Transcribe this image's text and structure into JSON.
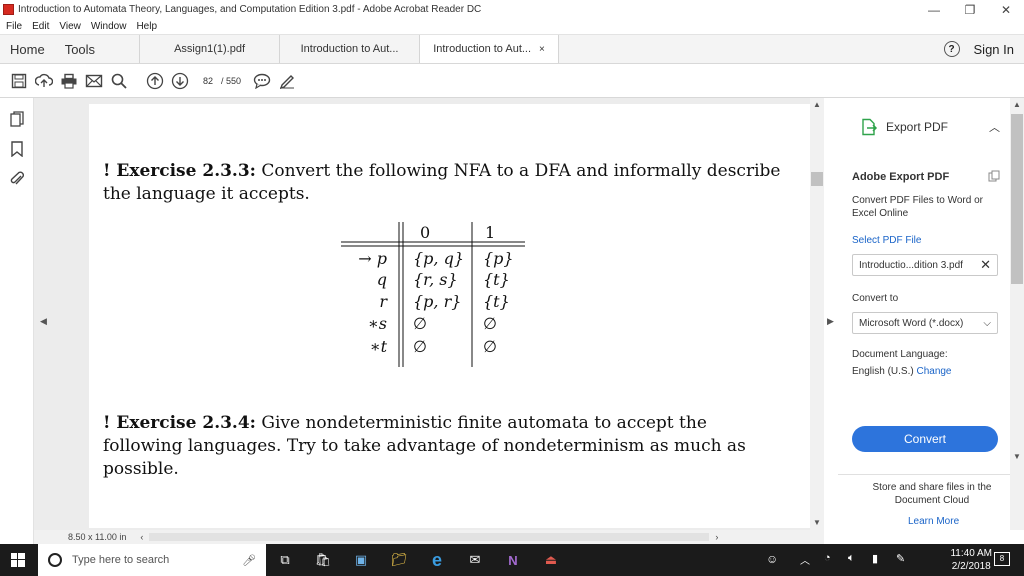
{
  "window": {
    "title": "Introduction to Automata Theory, Languages, and Computation Edition 3.pdf - Adobe Acrobat Reader DC"
  },
  "menu": [
    "File",
    "Edit",
    "View",
    "Window",
    "Help"
  ],
  "nav": {
    "home": "Home",
    "tools": "Tools"
  },
  "tabs": [
    {
      "label": "Assign1(1).pdf"
    },
    {
      "label": "Introduction to Aut..."
    },
    {
      "label": "Introduction to Aut..."
    }
  ],
  "tab_close": "×",
  "signin": "Sign In",
  "help_glyph": "?",
  "toolbar": {
    "current_page": "82",
    "page_sep": "/ 550"
  },
  "doc": {
    "ex1_label": "! Exercise 2.3.3:",
    "ex1_text": "Convert the following NFA to a DFA and informally describe the language it accepts.",
    "ex2_label": "! Exercise 2.3.4:",
    "ex2_text": "Give nondeterministic finite automata to accept the following languages. Try to take advantage of nondeterminism as much as possible.",
    "table": {
      "headers": [
        "",
        "0",
        "1"
      ],
      "rows": [
        [
          "→ p",
          "{p, q}",
          "{p}"
        ],
        [
          "q",
          "{r, s}",
          "{t}"
        ],
        [
          "r",
          "{p, r}",
          "{t}"
        ],
        [
          "∗s",
          "∅",
          "∅"
        ],
        [
          "∗t",
          "∅",
          "∅"
        ]
      ]
    }
  },
  "status": {
    "page_size": "8.50 x 11.00 in"
  },
  "panel": {
    "export_title": "Export PDF",
    "heading": "Adobe Export PDF",
    "desc": "Convert PDF Files to Word or Excel Online",
    "select_label": "Select PDF File",
    "file_name": "Introductio...dition 3.pdf",
    "convert_to_label": "Convert to",
    "format": "Microsoft Word (*.docx)",
    "lang_label": "Document Language:",
    "lang_value": "English (U.S.)",
    "lang_change": "Change",
    "convert_button": "Convert",
    "store_text": "Store and share files in the Document Cloud",
    "learn_more": "Learn More"
  },
  "taskbar": {
    "search_placeholder": "Type here to search",
    "time": "11:40 AM",
    "date": "2/2/2018",
    "notif_count": "8"
  }
}
